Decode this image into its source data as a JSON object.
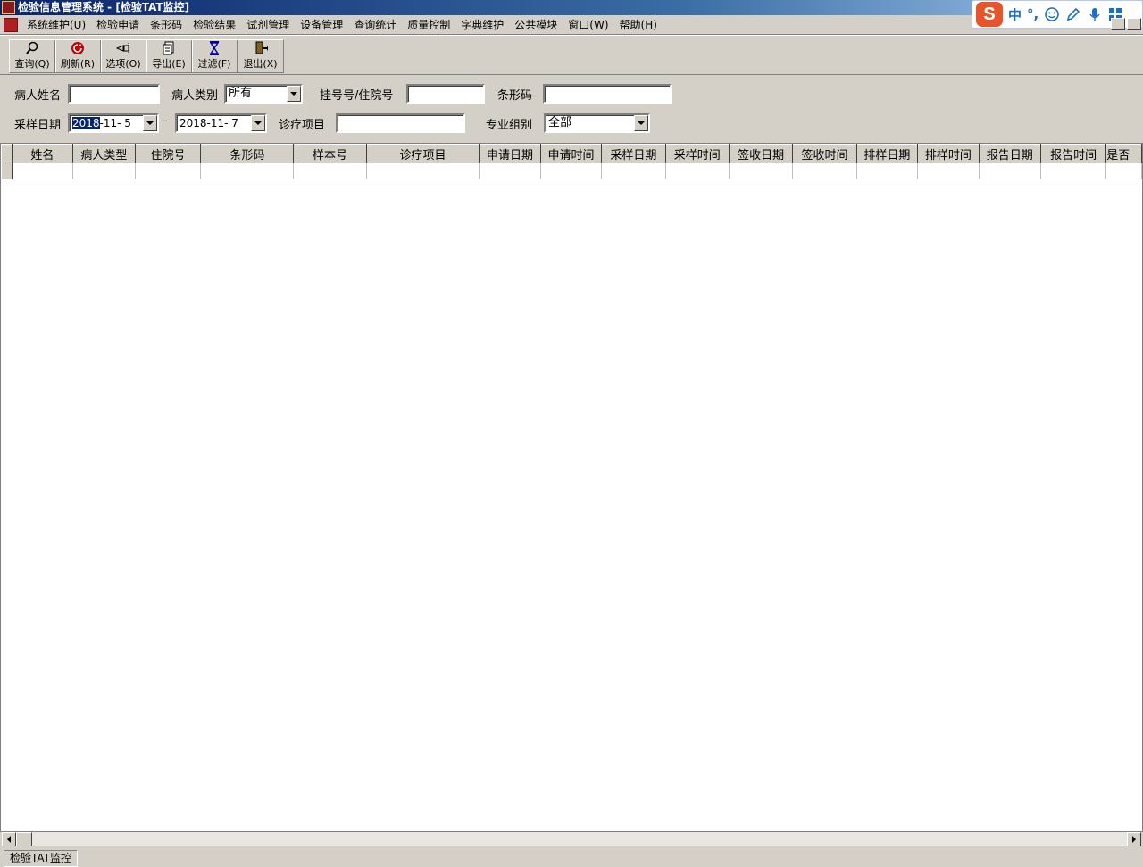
{
  "window": {
    "title": "检验信息管理系统 - [检验TAT监控]"
  },
  "ime": {
    "lang": "中",
    "punct": "°,"
  },
  "menu": [
    "系统维护(U)",
    "检验申请",
    "条形码",
    "检验结果",
    "试剂管理",
    "设备管理",
    "查询统计",
    "质量控制",
    "字典维护",
    "公共模块",
    "窗口(W)",
    "帮助(H)"
  ],
  "toolbar": {
    "query": "查询(Q)",
    "refresh": "刷新(R)",
    "options": "选项(O)",
    "export": "导出(E)",
    "filter": "过滤(F)",
    "exit": "退出(X)"
  },
  "filters": {
    "patient_name_label": "病人姓名",
    "patient_name_value": "",
    "patient_type_label": "病人类别",
    "patient_type_value": "所有",
    "reg_no_label": "挂号号/住院号",
    "reg_no_value": "",
    "barcode_label": "条形码",
    "barcode_value": "",
    "sample_date_label": "采样日期",
    "date_from_selected": "2018",
    "date_from_rest": "-11- 5",
    "date_sep": "-",
    "date_to": "2018-11- 7",
    "project_label": "诊疗项目",
    "project_value": "",
    "group_label": "专业组别",
    "group_value": "全部"
  },
  "grid": {
    "columns": [
      "姓名",
      "病人类型",
      "住院号",
      "条形码",
      "样本号",
      "诊疗项目",
      "申请日期",
      "申请时间",
      "采样日期",
      "采样时间",
      "签收日期",
      "签收时间",
      "排样日期",
      "排样时间",
      "报告日期",
      "报告时间",
      "是否"
    ]
  },
  "status": {
    "tab": "检验TAT监控"
  }
}
